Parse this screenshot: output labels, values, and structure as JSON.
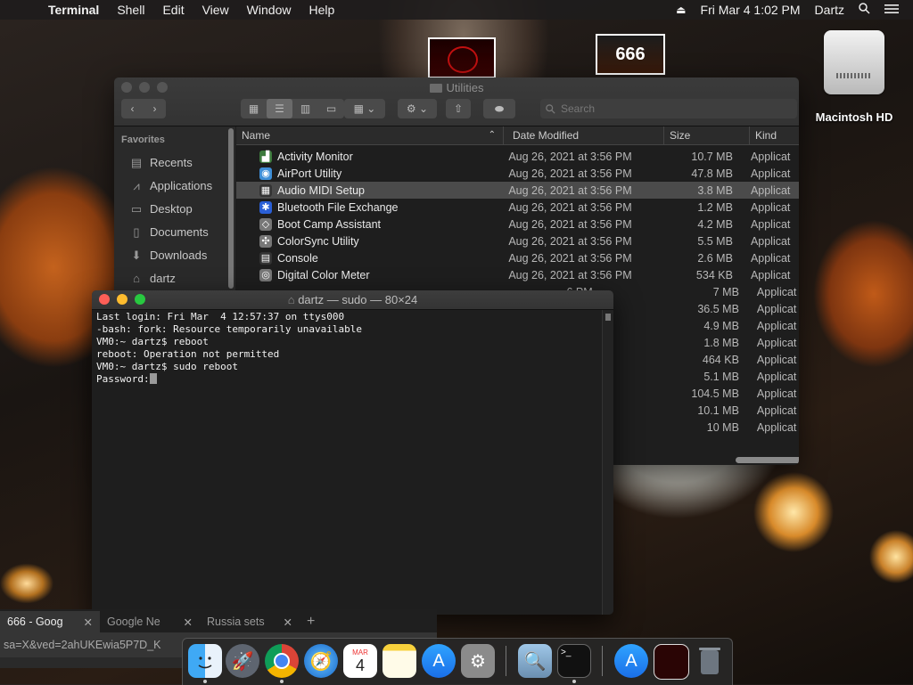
{
  "menubar": {
    "apple": "",
    "app": "Terminal",
    "items": [
      "Shell",
      "Edit",
      "View",
      "Window",
      "Help"
    ],
    "datetime": "Fri Mar 4  1:02 PM",
    "user": "Dartz"
  },
  "desktop": {
    "drive_label": "Macintosh HD",
    "thumb2_text": "666"
  },
  "finder": {
    "title": "Utilities",
    "search_placeholder": "Search",
    "sidebar_heading": "Favorites",
    "sidebar": [
      "Recents",
      "Applications",
      "Desktop",
      "Documents",
      "Downloads",
      "dartz"
    ],
    "columns": {
      "name": "Name",
      "date": "Date Modified",
      "size": "Size",
      "kind": "Kind"
    },
    "rows": [
      {
        "name": "Activity Monitor",
        "date": "Aug 26, 2021 at 3:56 PM",
        "size": "10.7 MB",
        "kind": "Applicat"
      },
      {
        "name": "AirPort Utility",
        "date": "Aug 26, 2021 at 3:56 PM",
        "size": "47.8 MB",
        "kind": "Applicat"
      },
      {
        "name": "Audio MIDI Setup",
        "date": "Aug 26, 2021 at 3:56 PM",
        "size": "3.8 MB",
        "kind": "Applicat"
      },
      {
        "name": "Bluetooth File Exchange",
        "date": "Aug 26, 2021 at 3:56 PM",
        "size": "1.2 MB",
        "kind": "Applicat"
      },
      {
        "name": "Boot Camp Assistant",
        "date": "Aug 26, 2021 at 3:56 PM",
        "size": "4.2 MB",
        "kind": "Applicat"
      },
      {
        "name": "ColorSync Utility",
        "date": "Aug 26, 2021 at 3:56 PM",
        "size": "5.5 MB",
        "kind": "Applicat"
      },
      {
        "name": "Console",
        "date": "Aug 26, 2021 at 3:56 PM",
        "size": "2.6 MB",
        "kind": "Applicat"
      },
      {
        "name": "Digital Color Meter",
        "date": "Aug 26, 2021 at 3:56 PM",
        "size": "534 KB",
        "kind": "Applicat"
      },
      {
        "name": "",
        "date": "6 PM",
        "size": "7 MB",
        "kind": "Applicat"
      },
      {
        "name": "",
        "date": "6 PM",
        "size": "36.5 MB",
        "kind": "Applicat"
      },
      {
        "name": "",
        "date": "6 PM",
        "size": "4.9 MB",
        "kind": "Applicat"
      },
      {
        "name": "",
        "date": "6 PM",
        "size": "1.8 MB",
        "kind": "Applicat"
      },
      {
        "name": "",
        "date": "6 PM",
        "size": "464 KB",
        "kind": "Applicat"
      },
      {
        "name": "",
        "date": "6 PM",
        "size": "5.1 MB",
        "kind": "Applicat"
      },
      {
        "name": "",
        "date": "6 PM",
        "size": "104.5 MB",
        "kind": "Applicat"
      },
      {
        "name": "",
        "date": "6 PM",
        "size": "10.1 MB",
        "kind": "Applicat"
      },
      {
        "name": "",
        "date": "6 PM",
        "size": "10 MB",
        "kind": "Applicat"
      }
    ]
  },
  "terminal": {
    "title": "dartz — sudo — 80×24",
    "lines": [
      "Last login: Fri Mar  4 12:57:37 on ttys000",
      "-bash: fork: Resource temporarily unavailable",
      "VM0:~ dartz$ reboot",
      "reboot: Operation not permitted",
      "VM0:~ dartz$ sudo reboot",
      "Password:"
    ]
  },
  "browser": {
    "tabs": [
      "666 - Goog",
      "Google Ne",
      "Russia sets"
    ],
    "new_tab": "+",
    "url": "sa=X&ved=2ahUKEwia5P7D_K"
  },
  "dock": {
    "calendar_month": "MAR",
    "calendar_day": "4"
  }
}
